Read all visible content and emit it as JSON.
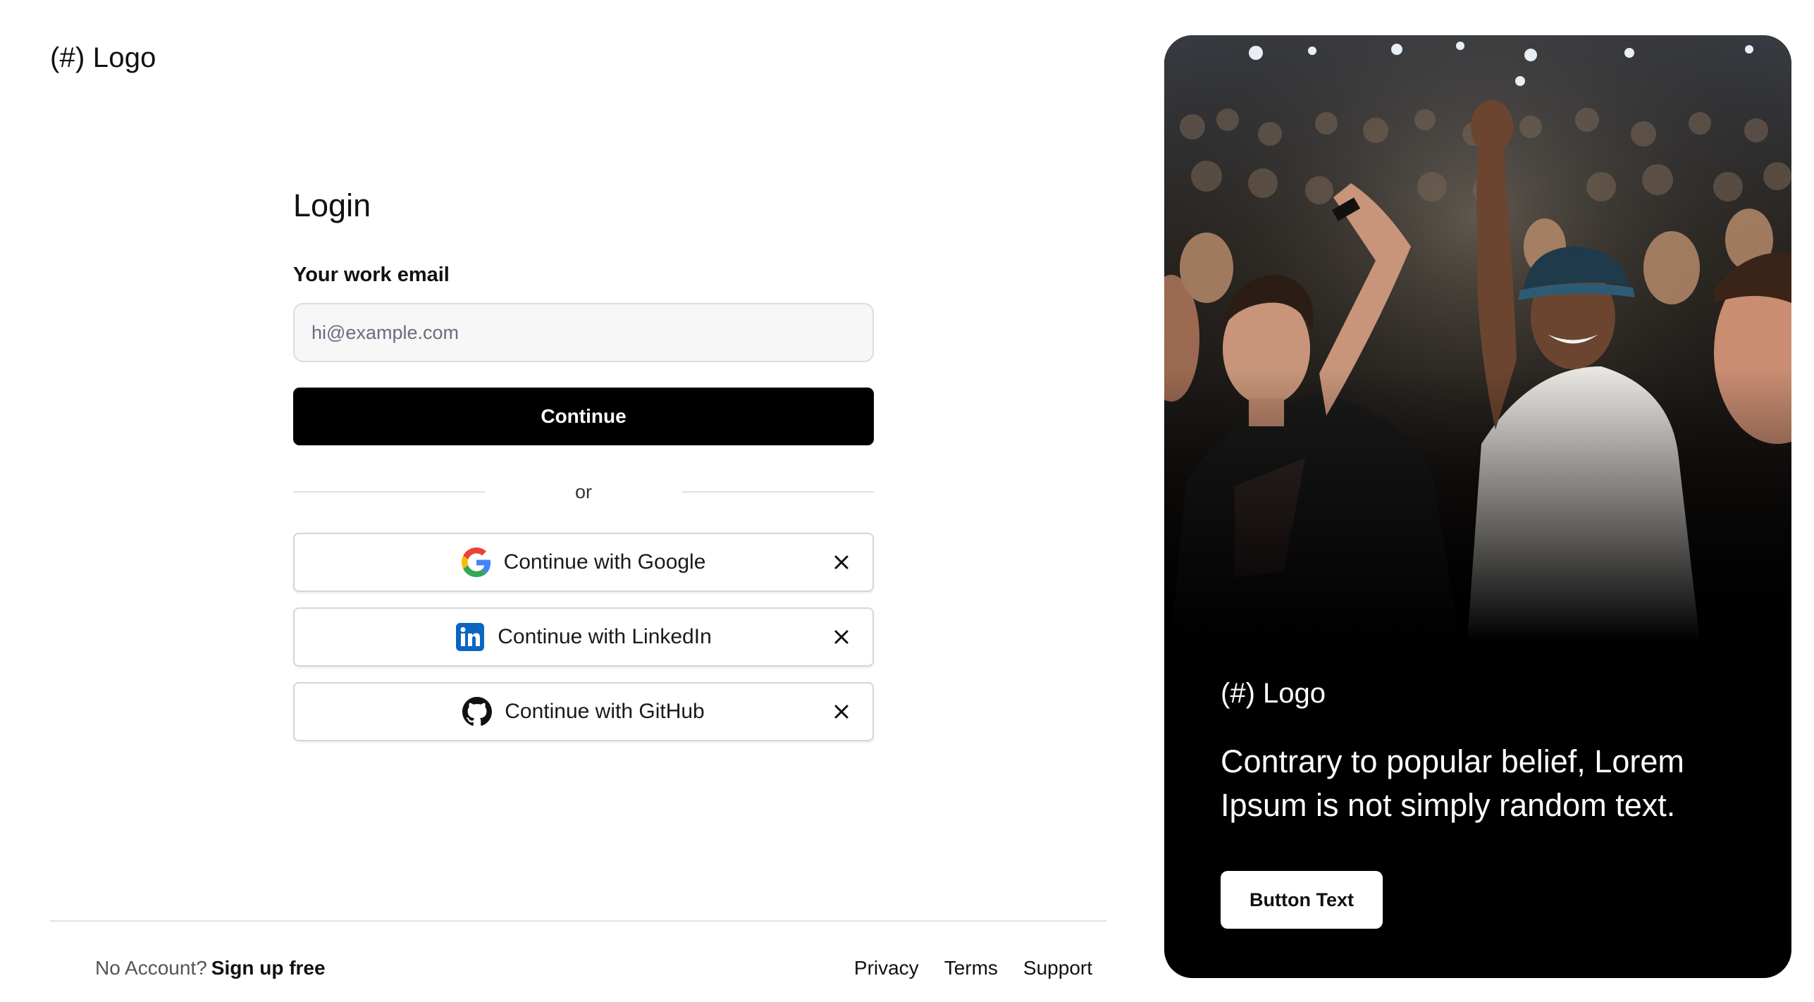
{
  "brand": {
    "logo_text": "(#) Logo"
  },
  "login": {
    "title": "Login",
    "email_label": "Your work email",
    "email_placeholder": "hi@example.com",
    "email_value": "",
    "continue_label": "Continue",
    "divider_text": "or",
    "social": [
      {
        "label": "Continue with Google",
        "icon": "google-icon"
      },
      {
        "label": "Continue with LinkedIn",
        "icon": "linkedin-icon"
      },
      {
        "label": "Continue with GitHub",
        "icon": "github-icon"
      }
    ]
  },
  "footer": {
    "no_account": "No Account?",
    "signup": "Sign up free",
    "links": [
      "Privacy",
      "Terms",
      "Support"
    ]
  },
  "promo": {
    "logo_text": "(#) Logo",
    "headline": "Contrary to popular belief, Lorem Ipsum is not simply random text.",
    "button_label": "Button Text",
    "image": "concert-crowd-photo"
  },
  "colors": {
    "primary_button": "#000000",
    "panel_background": "#000000",
    "input_background": "#f7f7f7",
    "linkedin_blue": "#0a66c2"
  }
}
